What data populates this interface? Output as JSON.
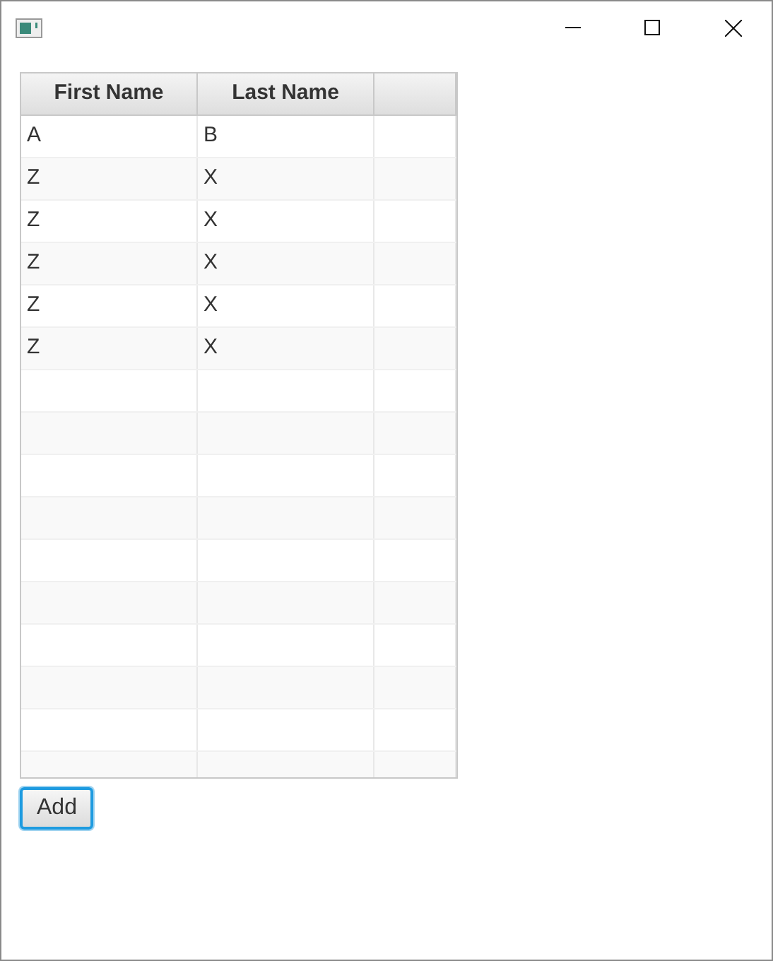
{
  "table": {
    "columns": [
      {
        "label": "First Name"
      },
      {
        "label": "Last Name"
      },
      {}
    ],
    "rows": [
      [
        "A",
        "B"
      ],
      [
        "Z",
        "X"
      ],
      [
        "Z",
        "X"
      ],
      [
        "Z",
        "X"
      ],
      [
        "Z",
        "X"
      ],
      [
        "Z",
        "X"
      ]
    ]
  },
  "buttons": [
    {
      "label": "Add",
      "focused": true
    }
  ]
}
